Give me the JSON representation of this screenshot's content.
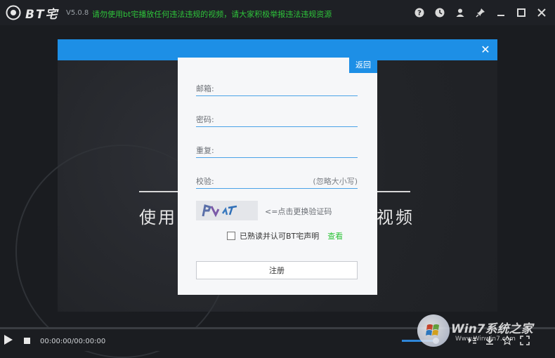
{
  "app": {
    "brand": "BT宅",
    "version": "V5.0.8",
    "notice": "请勿使用bt宅播放任何违法违规的视频，请大家积极举报违法违规资源"
  },
  "titlebar_icons": [
    "help-icon",
    "history-icon",
    "user-icon",
    "pin-icon",
    "minimize-icon",
    "maximize-icon",
    "close-icon"
  ],
  "video": {
    "caption_left": "使用",
    "caption_right": "视频"
  },
  "dialog": {
    "back_label": "返回",
    "fields": {
      "email_label": "邮箱:",
      "password_label": "密码:",
      "repeat_label": "重复:",
      "verify_label": "校验:",
      "verify_hint": "(忽略大小写)"
    },
    "captcha_tip": "<=点击更换验证码",
    "agree_text": "已熟读并认可BT宅声明",
    "view_link": "查看",
    "register_label": "注册"
  },
  "player": {
    "time": "00:00:00/00:00:00",
    "volume_fraction": 0.85
  },
  "watermark": {
    "title": "Win7系统之家",
    "subtitle": "Www.Winwin7.com"
  },
  "colors": {
    "accent": "#1d8fe6",
    "notice": "#2ec43a",
    "link": "#2ec43a"
  }
}
